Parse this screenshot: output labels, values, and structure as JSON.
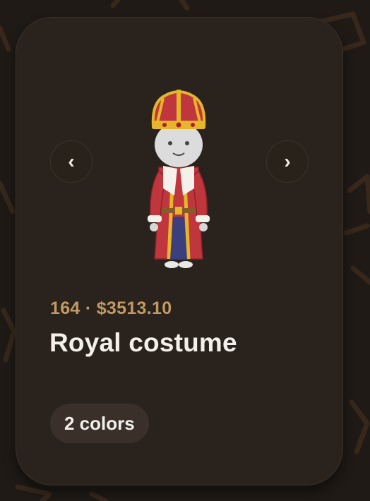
{
  "background": {
    "color": "#1f1a16",
    "pattern_color": "#3a2a1c"
  },
  "card": {
    "color": "#2a231d",
    "accent_color": "#c29a63",
    "nav": {
      "prev_label": "‹",
      "next_label": "›"
    },
    "product": {
      "image_icon": "royal-costume-figure-icon",
      "count": "164",
      "separator": "·",
      "price": "$3513.10",
      "price_line": "164 · $3513.10",
      "name": "Royal costume"
    },
    "colors_label": "2 colors"
  }
}
